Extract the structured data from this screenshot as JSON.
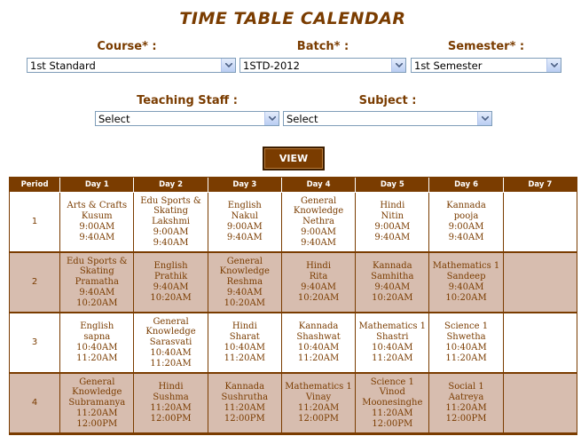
{
  "title": "TIME TABLE CALENDAR",
  "filters": {
    "course": {
      "label": "Course* :",
      "value": "1st Standard"
    },
    "batch": {
      "label": "Batch* :",
      "value": "1STD-2012"
    },
    "semester": {
      "label": "Semester* :",
      "value": "1st Semester"
    },
    "teaching_staff": {
      "label": "Teaching Staff :",
      "value": "Select"
    },
    "subject": {
      "label": "Subject :",
      "value": "Select"
    }
  },
  "view_button": "VIEW",
  "table": {
    "headers": [
      "Period",
      "Day 1",
      "Day 2",
      "Day 3",
      "Day 4",
      "Day 5",
      "Day 6",
      "Day 7"
    ],
    "rows": [
      {
        "period": "1",
        "cells": [
          [
            "Arts & Crafts",
            "Kusum",
            "9:00AM",
            "9:40AM"
          ],
          [
            "Edu Sports &",
            "Skating",
            "Lakshmi",
            "9:00AM",
            "9:40AM"
          ],
          [
            "English",
            "Nakul",
            "9:00AM",
            "9:40AM"
          ],
          [
            "General",
            "Knowledge",
            "Nethra",
            "9:00AM",
            "9:40AM"
          ],
          [
            "Hindi",
            "Nitin",
            "9:00AM",
            "9:40AM"
          ],
          [
            "Kannada",
            "pooja",
            "9:00AM",
            "9:40AM"
          ],
          []
        ]
      },
      {
        "period": "2",
        "cells": [
          [
            "Edu Sports &",
            "Skating",
            "Pramatha",
            "9:40AM",
            "10:20AM"
          ],
          [
            "English",
            "Prathik",
            "9:40AM",
            "10:20AM"
          ],
          [
            "General",
            "Knowledge",
            "Reshma",
            "9:40AM",
            "10:20AM"
          ],
          [
            "Hindi",
            "Rita",
            "9:40AM",
            "10:20AM"
          ],
          [
            "Kannada",
            "Samhitha",
            "9:40AM",
            "10:20AM"
          ],
          [
            "Mathematics 1",
            "Sandeep",
            "9:40AM",
            "10:20AM"
          ],
          []
        ]
      },
      {
        "period": "3",
        "cells": [
          [
            "English",
            "sapna",
            "10:40AM",
            "11:20AM"
          ],
          [
            "General",
            "Knowledge",
            "Sarasvati",
            "10:40AM",
            "11:20AM"
          ],
          [
            "Hindi",
            "Sharat",
            "10:40AM",
            "11:20AM"
          ],
          [
            "Kannada",
            "Shashwat",
            "10:40AM",
            "11:20AM"
          ],
          [
            "Mathematics 1",
            "Shastri",
            "10:40AM",
            "11:20AM"
          ],
          [
            "Science 1",
            "Shwetha",
            "10:40AM",
            "11:20AM"
          ],
          []
        ]
      },
      {
        "period": "4",
        "cells": [
          [
            "General",
            "Knowledge",
            "Subramanya",
            "11:20AM",
            "12:00PM"
          ],
          [
            "Hindi",
            "Sushma",
            "11:20AM",
            "12:00PM"
          ],
          [
            "Kannada",
            "Sushrutha",
            "11:20AM",
            "12:00PM"
          ],
          [
            "Mathematics 1",
            "Vinay",
            "11:20AM",
            "12:00PM"
          ],
          [
            "Science 1",
            "Vinod",
            "Moonesinghe",
            "11:20AM",
            "12:00PM"
          ],
          [
            "Social 1",
            "Aatreya",
            "11:20AM",
            "12:00PM"
          ],
          []
        ]
      }
    ]
  }
}
